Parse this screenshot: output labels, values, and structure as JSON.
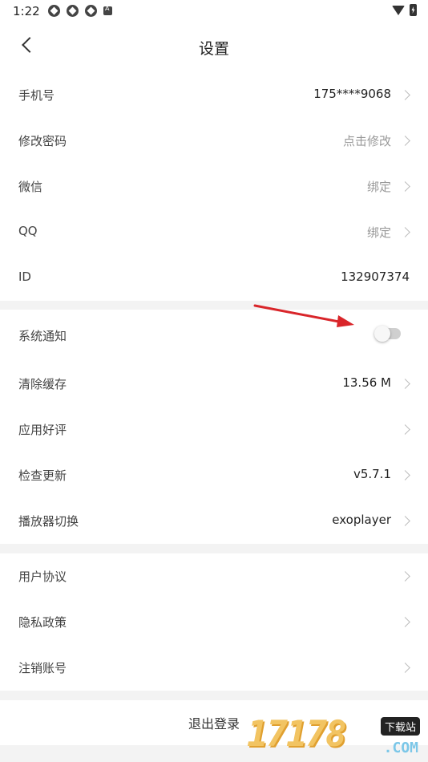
{
  "status_bar": {
    "time": "1:22"
  },
  "header": {
    "title": "设置"
  },
  "group1": [
    {
      "label": "手机号",
      "value": "175****9068"
    },
    {
      "label": "修改密码",
      "value": "点击修改"
    },
    {
      "label": "微信",
      "value": "绑定"
    },
    {
      "label": "QQ",
      "value": "绑定"
    },
    {
      "label": "ID",
      "value": "132907374"
    }
  ],
  "group2": [
    {
      "label": "系统通知",
      "toggle_on": false
    },
    {
      "label": "清除缓存",
      "value": "13.56 M"
    },
    {
      "label": "应用好评",
      "value": ""
    },
    {
      "label": "检查更新",
      "value": "v5.7.1"
    },
    {
      "label": "播放器切换",
      "value": "exoplayer"
    }
  ],
  "group3": [
    {
      "label": "用户协议"
    },
    {
      "label": "隐私政策"
    },
    {
      "label": "注销账号"
    }
  ],
  "logout": {
    "label": "退出登录"
  },
  "watermark": {
    "number": "17178",
    "tag": "下载站",
    "domain": ".COM"
  },
  "colors": {
    "annotation_arrow": "#d9252a",
    "toggle_track": "#cfcfcf"
  }
}
